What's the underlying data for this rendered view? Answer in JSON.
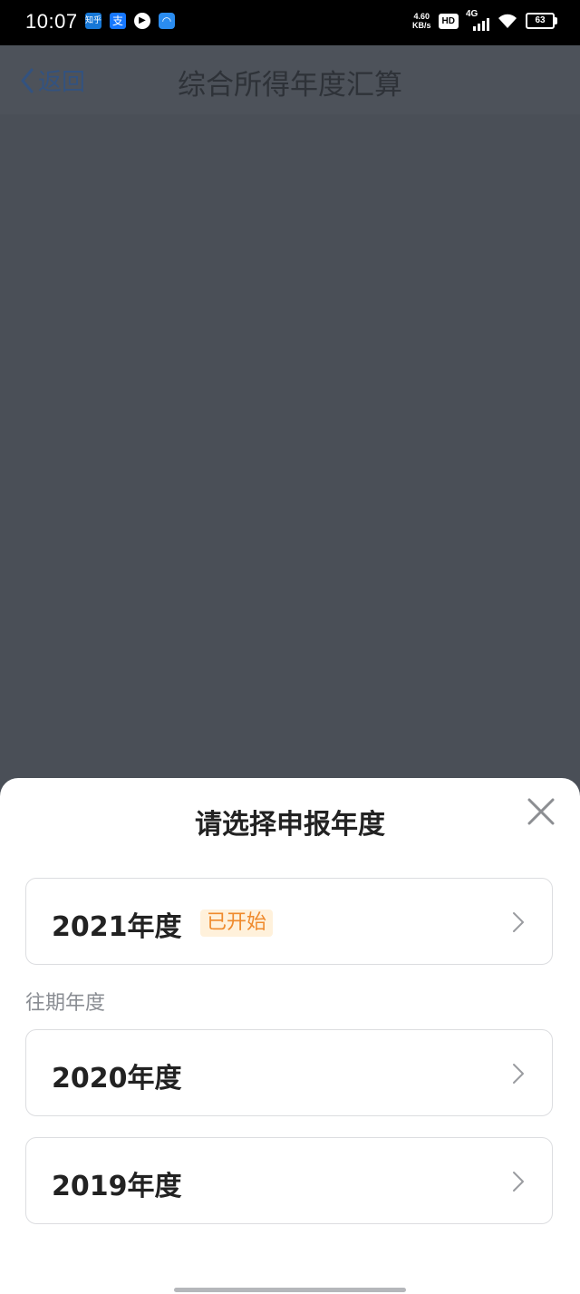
{
  "status_bar": {
    "time": "10:07",
    "net_speed_value": "4.60",
    "net_speed_unit": "KB/s",
    "hd_label": "HD",
    "network_type": "4G",
    "battery_level": "63",
    "notifications": [
      {
        "icon": "zhihu-icon",
        "glyph": "知乎"
      },
      {
        "icon": "alipay-icon",
        "glyph": "支"
      },
      {
        "icon": "video-play-icon",
        "glyph": "▶"
      },
      {
        "icon": "app-icon",
        "glyph": "◠"
      }
    ]
  },
  "nav": {
    "back_label": "返回",
    "title": "综合所得年度汇算"
  },
  "sheet": {
    "title": "请选择申报年度",
    "current_year": {
      "label": "2021年度",
      "badge": "已开始"
    },
    "past_section_label": "往期年度",
    "past_years": [
      {
        "label": "2020年度"
      },
      {
        "label": "2019年度"
      }
    ]
  },
  "colors": {
    "overlay": "#4a4f57",
    "badge_text": "#ef8a2c",
    "badge_bg": "#fff1db",
    "back_link": "#33527f"
  }
}
